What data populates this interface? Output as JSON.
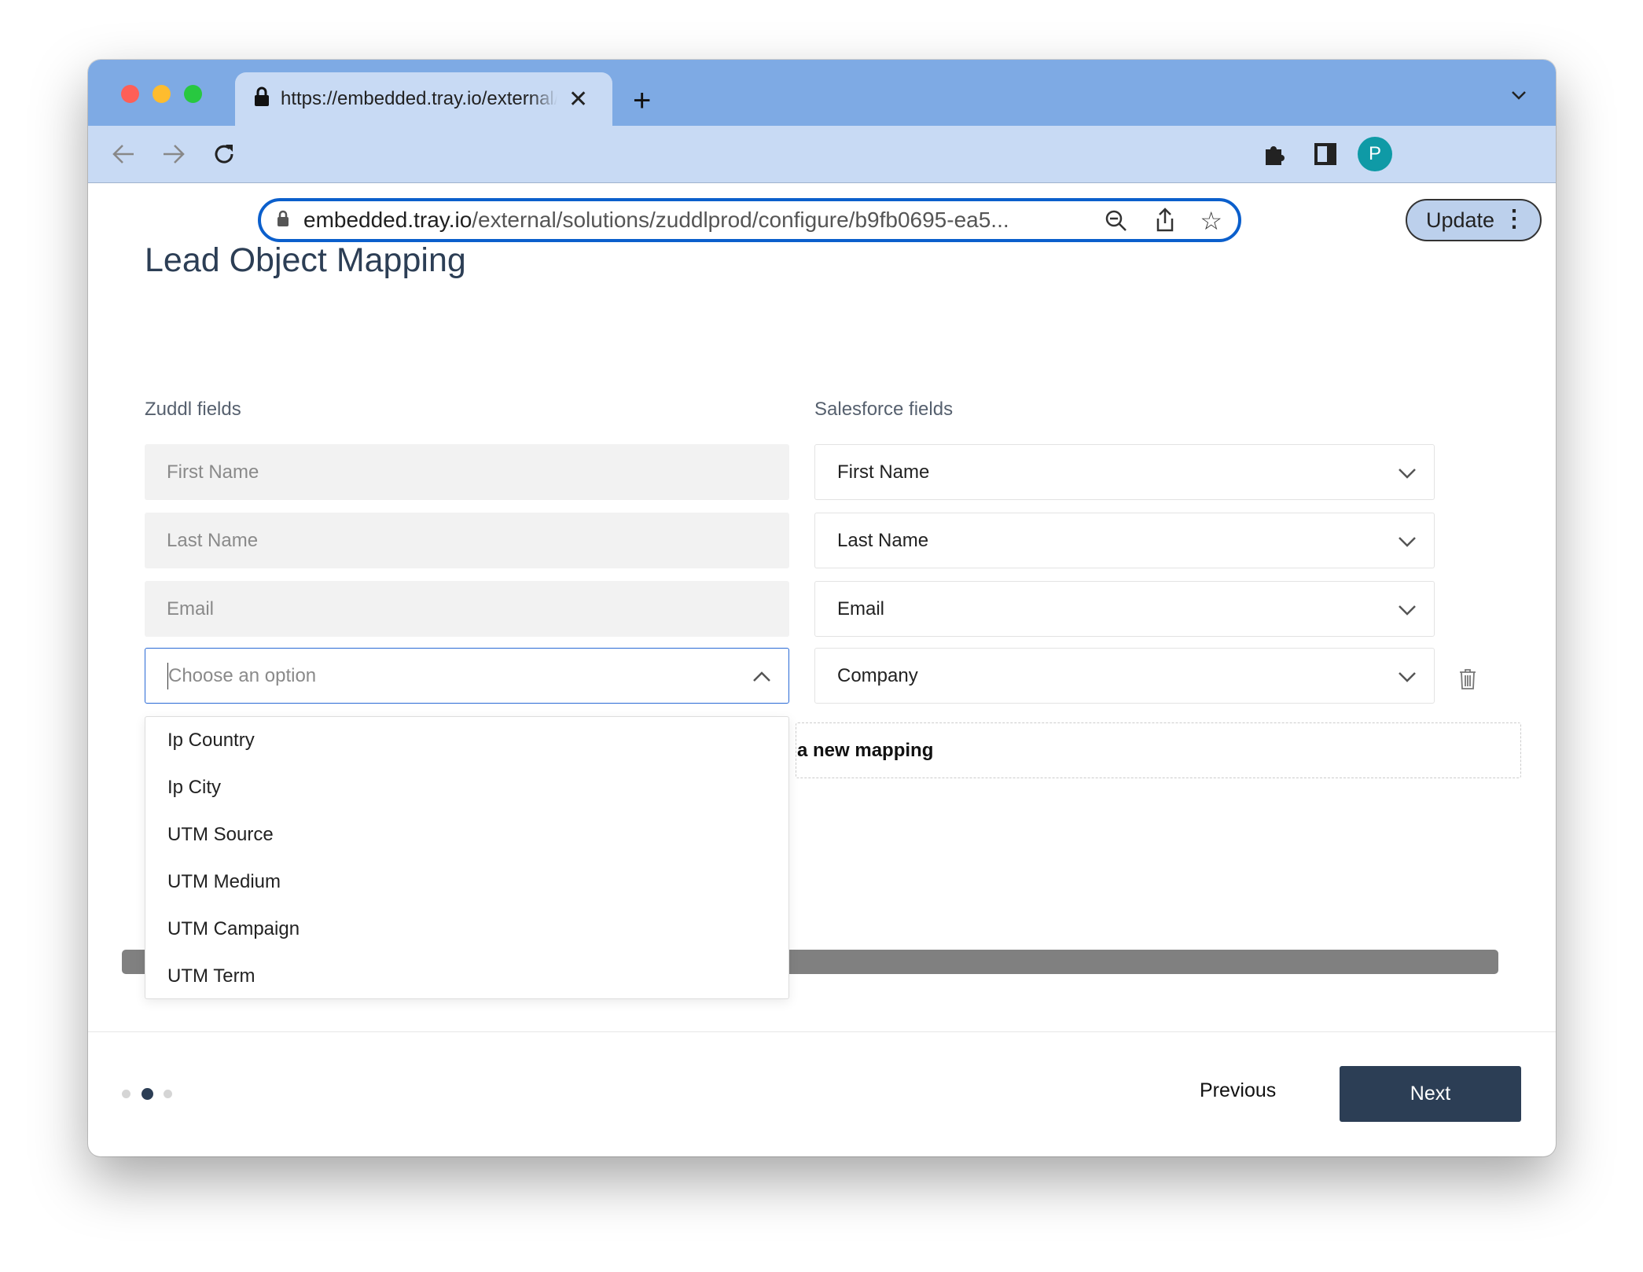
{
  "browser": {
    "tab_title": "https://embedded.tray.io/external/solutions/zuddlprod/configure/",
    "url_host": "embedded.tray.io",
    "url_path": "/external/solutions/zuddlprod/configure/b9fb0695-ea5...",
    "profile_initial": "P",
    "update_label": "Update",
    "colors": {
      "tabstrip": "#7eaae4",
      "toolbar": "#c8daf4",
      "omnibox_border": "#0b5fcc",
      "avatar": "#0f9aa6"
    }
  },
  "page": {
    "title": "Lead Object Mapping",
    "left_header": "Zuddl fields",
    "right_header": "Salesforce fields",
    "rows": [
      {
        "zuddl": "First Name",
        "salesforce": "First Name"
      },
      {
        "zuddl": "Last Name",
        "salesforce": "Last Name"
      },
      {
        "zuddl": "Email",
        "salesforce": "Email"
      },
      {
        "zuddl_placeholder": "Choose an option",
        "salesforce": "Company"
      }
    ],
    "dropdown_options": [
      "Ip Country",
      "Ip City",
      "UTM Source",
      "UTM Medium",
      "UTM Campaign",
      "UTM Term"
    ],
    "add_mapping_visible_text": "a new mapping",
    "steps": {
      "total": 3,
      "current": 2
    },
    "previous_label": "Previous",
    "next_label": "Next",
    "accent": "#2c3e55"
  }
}
